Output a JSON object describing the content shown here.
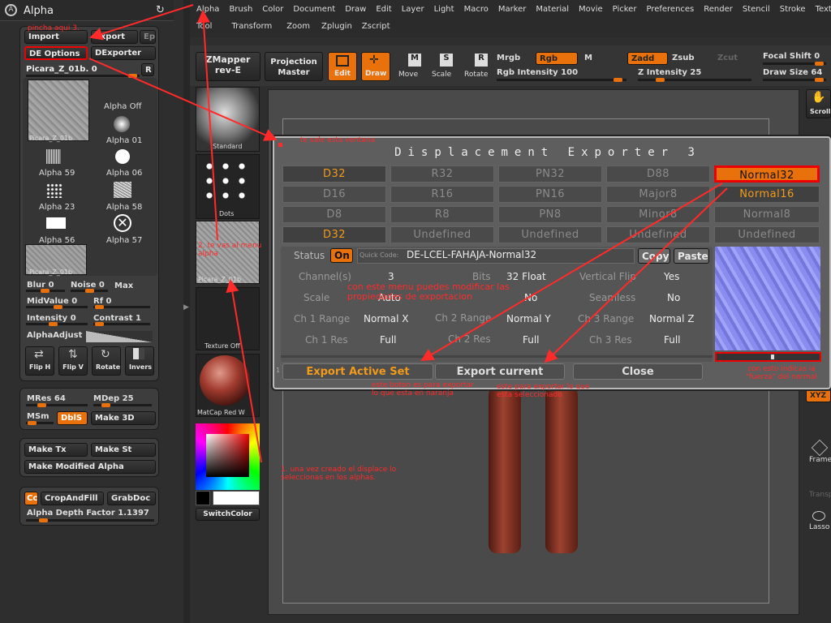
{
  "alpha_panel": {
    "title": "Alpha",
    "import": "Import",
    "export": "Export",
    "ep": "Ep",
    "de_options": "DE Options",
    "dexporter": "DExporter",
    "texture_name": "Picara_Z_01b. 0",
    "r": "R",
    "selected_caption": "Picara_Z_01b",
    "alpha_off": "Alpha Off",
    "grid": [
      "Alpha 01",
      "Alpha 59",
      "Alpha 06",
      "Alpha 23",
      "Alpha 58",
      "Alpha 56",
      "Alpha 57"
    ],
    "sub_caption": "Picara_Z_01b",
    "blur_label": "Blur",
    "blur_val": "0",
    "noise_label": "Noise",
    "noise_val": "0",
    "max": "Max",
    "midvalue_label": "MidValue",
    "midvalue_val": "0",
    "rf_label": "Rf",
    "rf_val": "0",
    "intensity_label": "Intensity",
    "intensity_val": "0",
    "contrast_label": "Contrast",
    "contrast_val": "1",
    "alphaadjust": "AlphaAdjust",
    "flip_h": "Flip H",
    "flip_v": "Flip V",
    "rotate": "Rotate",
    "invers": "Invers",
    "mres": "MRes 64",
    "mdep": "MDep 25",
    "msm": "MSm",
    "dbls": "DblS",
    "make3d": "Make 3D",
    "make_tx": "Make Tx",
    "make_st": "Make St",
    "make_modified": "Make Modified Alpha",
    "cc": "Cc",
    "cropandfill": "CropAndFill",
    "grabdoc": "GrabDoc",
    "depth_factor": "Alpha Depth Factor 1.1397"
  },
  "menu": {
    "row1": [
      "Alpha",
      "Brush",
      "Color",
      "Document",
      "Draw",
      "Edit",
      "Layer",
      "Light",
      "Macro",
      "Marker",
      "Material",
      "Movie",
      "Picker",
      "Preferences",
      "Render",
      "Stencil",
      "Stroke",
      "Texture"
    ],
    "row2": [
      "Tool",
      "Transform",
      "Zoom",
      "Zplugin",
      "Zscript"
    ]
  },
  "toolbar": {
    "zmapper": "ZMapper",
    "zmapper_sub": "rev-E",
    "projection": "Projection",
    "projection_sub": "Master",
    "edit": "Edit",
    "draw": "Draw",
    "move": "Move",
    "scale": "Scale",
    "rotate": "Rotate",
    "mrgb": "Mrgb",
    "rgb": "Rgb",
    "m": "M",
    "rgb_intensity": "Rgb Intensity 100",
    "zadd": "Zadd",
    "zsub": "Zsub",
    "zcut": "Zcut",
    "z_intensity": "Z Intensity 25",
    "focal_shift": "Focal Shift 0",
    "draw_size": "Draw Size 64"
  },
  "left_shelf": {
    "standard": "Standard",
    "dots": "Dots",
    "alpha_caption": "Picara_Z_01b",
    "texture_off": "Texture Off",
    "matcap": "MatCap Red W",
    "switchcolor": "SwitchColor"
  },
  "right_bar": {
    "scroll": "Scroll",
    "xyz": "XYZ",
    "frame": "Frame",
    "transp": "Transp",
    "lasso": "Lasso"
  },
  "dialog": {
    "title": "Displacement Exporter 3",
    "grid": [
      [
        "D32",
        "R32",
        "PN32",
        "D88",
        "Normal32"
      ],
      [
        "D16",
        "R16",
        "PN16",
        "Major8",
        "Normal16"
      ],
      [
        "D8",
        "R8",
        "PN8",
        "Minor8",
        "Normal8"
      ],
      [
        "D32",
        "Undefined",
        "Undefined",
        "Undefined",
        "Undefined"
      ]
    ],
    "status_label": "Status",
    "status_val": "On",
    "quick_code_label": "Quick Code:",
    "quick_code": "DE-LCEL-FAHAJA-Normal32",
    "copy": "Copy",
    "paste": "Paste",
    "channels_label": "Channel(s)",
    "channels_val": "3",
    "bits_label": "Bits",
    "bits_val": "32 Float",
    "vflip_label": "Vertical Flip",
    "vflip_val": "Yes",
    "scale_label": "Scale",
    "scale_val": "Auto",
    "unknown_val": "No",
    "seamless_label": "Seamless",
    "seamless_val": "No",
    "ch1_range_label": "Ch 1 Range",
    "ch1_range_val": "Normal X",
    "ch2_range_label": "Ch 2 Range",
    "ch2_range_val": "Normal Y",
    "ch3_range_label": "Ch 3 Range",
    "ch3_range_val": "Normal Z",
    "ch1_res_label": "Ch 1 Res",
    "ch1_res_val": "Full",
    "ch2_res_label": "Ch 2 Res",
    "ch2_res_val": "Full",
    "ch3_res_label": "Ch 3 Res",
    "ch3_res_val": "Full",
    "export_active": "Export Active Set",
    "export_current": "Export current",
    "close": "Close"
  },
  "annotations": {
    "pincha": "pincha aqui 3.",
    "ventana": "te sale esta ventana",
    "menu_alpha": "2. te vas al menu alpha",
    "propiedades": "con este menu puedes modificar las propiedades de exportacion",
    "boton_naranja": "este boton es para exportar lo que esta en naranja",
    "seleccionado": "este para exportar lo que esta seleccionado",
    "fuerza": "con esto indicas la \"fuerza\" del normal",
    "step1": "1. una vez creado el displace lo seleccionas en los alphas."
  },
  "colors": {
    "accent": "#e8710c",
    "annotation": "#ff2a2a"
  }
}
